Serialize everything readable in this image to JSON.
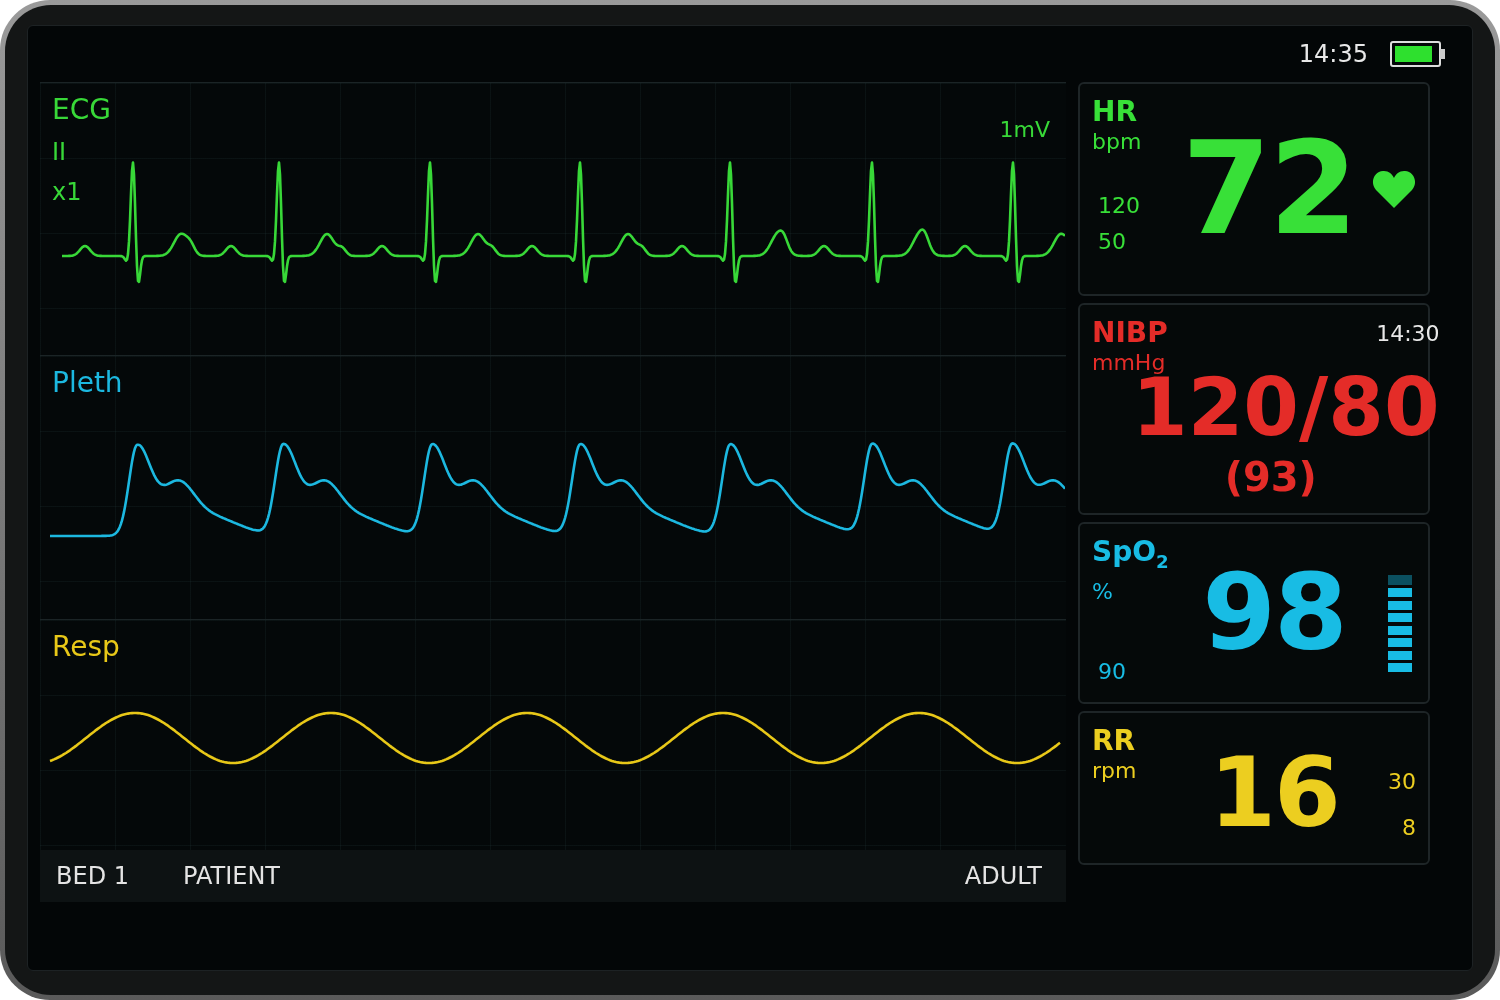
{
  "status": {
    "time": "14:35"
  },
  "waveforms": [
    {
      "kind": "ecg",
      "label": "ECG",
      "lead": "II",
      "gain": "x1",
      "scale": "1mV",
      "color": "#38d838"
    },
    {
      "kind": "pleth",
      "label": "Pleth",
      "color": "#1cb8e0"
    },
    {
      "kind": "resp",
      "label": "Resp",
      "color": "#e8c818"
    }
  ],
  "vitals": [
    {
      "kind": "hr",
      "label": "HR",
      "unit": "bpm",
      "value": "72",
      "limits": [
        "120",
        "50"
      ],
      "color": "#38e038"
    },
    {
      "kind": "nibp",
      "label": "NIBP",
      "unit": "mmHg",
      "time": "14:30",
      "value": "120/80",
      "mean": "(93)",
      "color": "#e42c28"
    },
    {
      "kind": "spo2",
      "label": "SpO$_{2}$",
      "unit": "%",
      "value": "98",
      "limits": [
        "90"
      ],
      "level": 0.875,
      "color": "#18bce4"
    },
    {
      "kind": "rr",
      "label": "RR",
      "unit": "rpm",
      "value": "16",
      "limits": [
        "30",
        "8"
      ],
      "color": "#ecce20"
    }
  ],
  "footer": {
    "bed": "BED 1",
    "patient": "PATIENT",
    "category": "ADULT"
  }
}
